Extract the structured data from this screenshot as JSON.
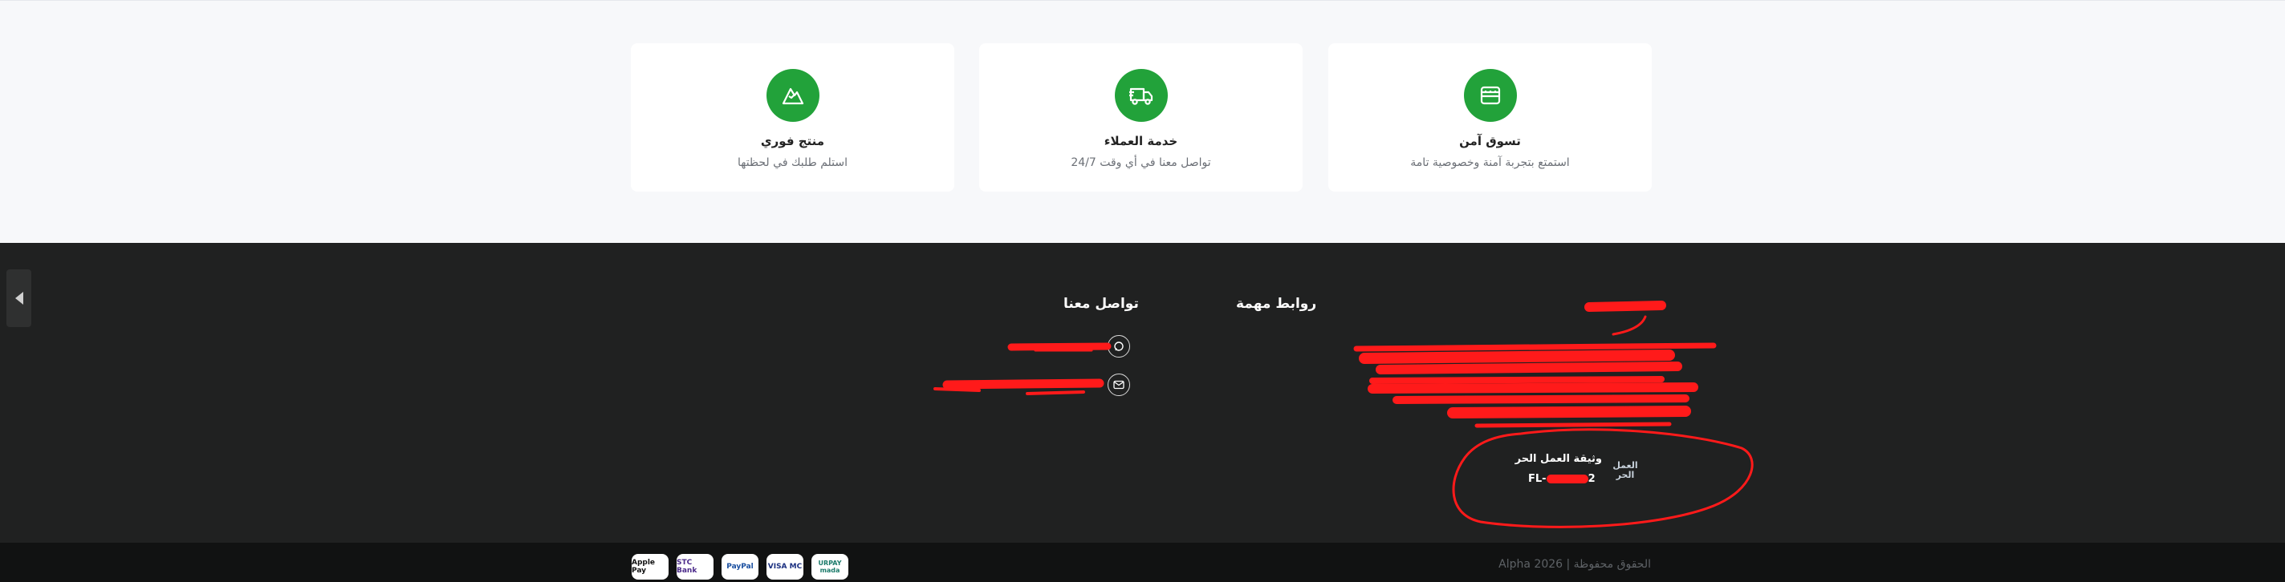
{
  "features": [
    {
      "title": "تسوق آمن",
      "subtitle": "استمتع بتجربة آمنة وخصوصية تامة",
      "icon": "shop-icon"
    },
    {
      "title": "خدمة العملاء",
      "subtitle": "تواصل معنا في أي وقت 24/7",
      "icon": "delivery-truck-icon"
    },
    {
      "title": "منتج فوري",
      "subtitle": "استلم طلبك في لحظتها",
      "icon": "mountain-icon"
    }
  ],
  "footer": {
    "important_links_heading": "روابط مهمة",
    "contact_heading": "تواصل معنا",
    "freelance_title": "وثيقة العمل الحر",
    "freelance_number": "FL-",
    "freelance_number_suffix": "2",
    "freelance_logo_text": "العمل الحر",
    "copyright": "الحقوق محفوظة | Alpha 2026"
  },
  "payments": [
    "Apple Pay",
    "STC Bank",
    "PayPal",
    "VISA MC",
    "URPAY mada"
  ],
  "colors": {
    "accent": "#22a23a",
    "footer_bg": "#202121",
    "redaction": "#ff1a1a"
  }
}
